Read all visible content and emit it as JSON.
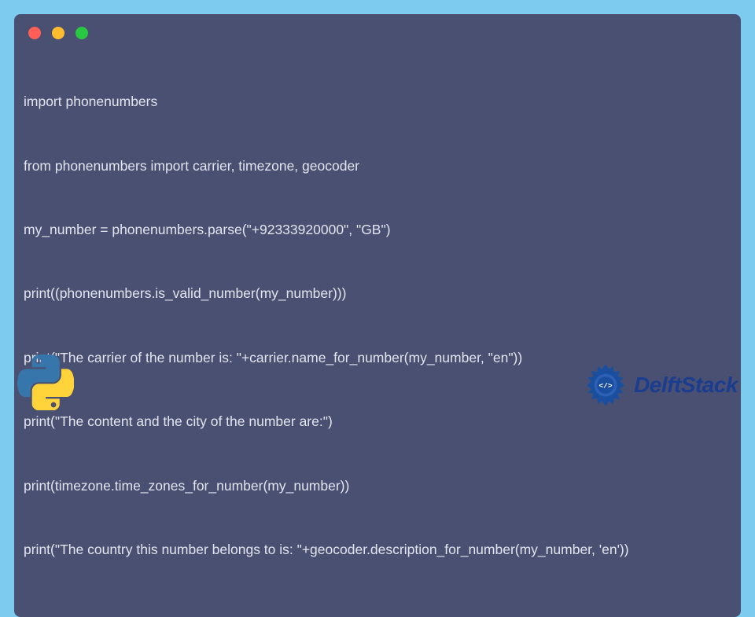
{
  "window": {
    "dots": {
      "red": "#ff5f57",
      "yellow": "#febc2e",
      "green": "#28c840"
    }
  },
  "code": {
    "lines": [
      "import phonenumbers",
      "from phonenumbers import carrier, timezone, geocoder",
      "my_number = phonenumbers.parse(\"+92333920000\", \"GB\")",
      "print((phonenumbers.is_valid_number(my_number)))",
      "print(\"The carrier of the number is: \"+carrier.name_for_number(my_number, \"en\"))",
      "print(\"The content and the city of the number are:\")",
      "print(timezone.time_zones_for_number(my_number))",
      "print(\"The country this number belongs to is: \"+geocoder.description_for_number(my_number, 'en'))"
    ]
  },
  "branding": {
    "delftstack": "DelftStack"
  }
}
